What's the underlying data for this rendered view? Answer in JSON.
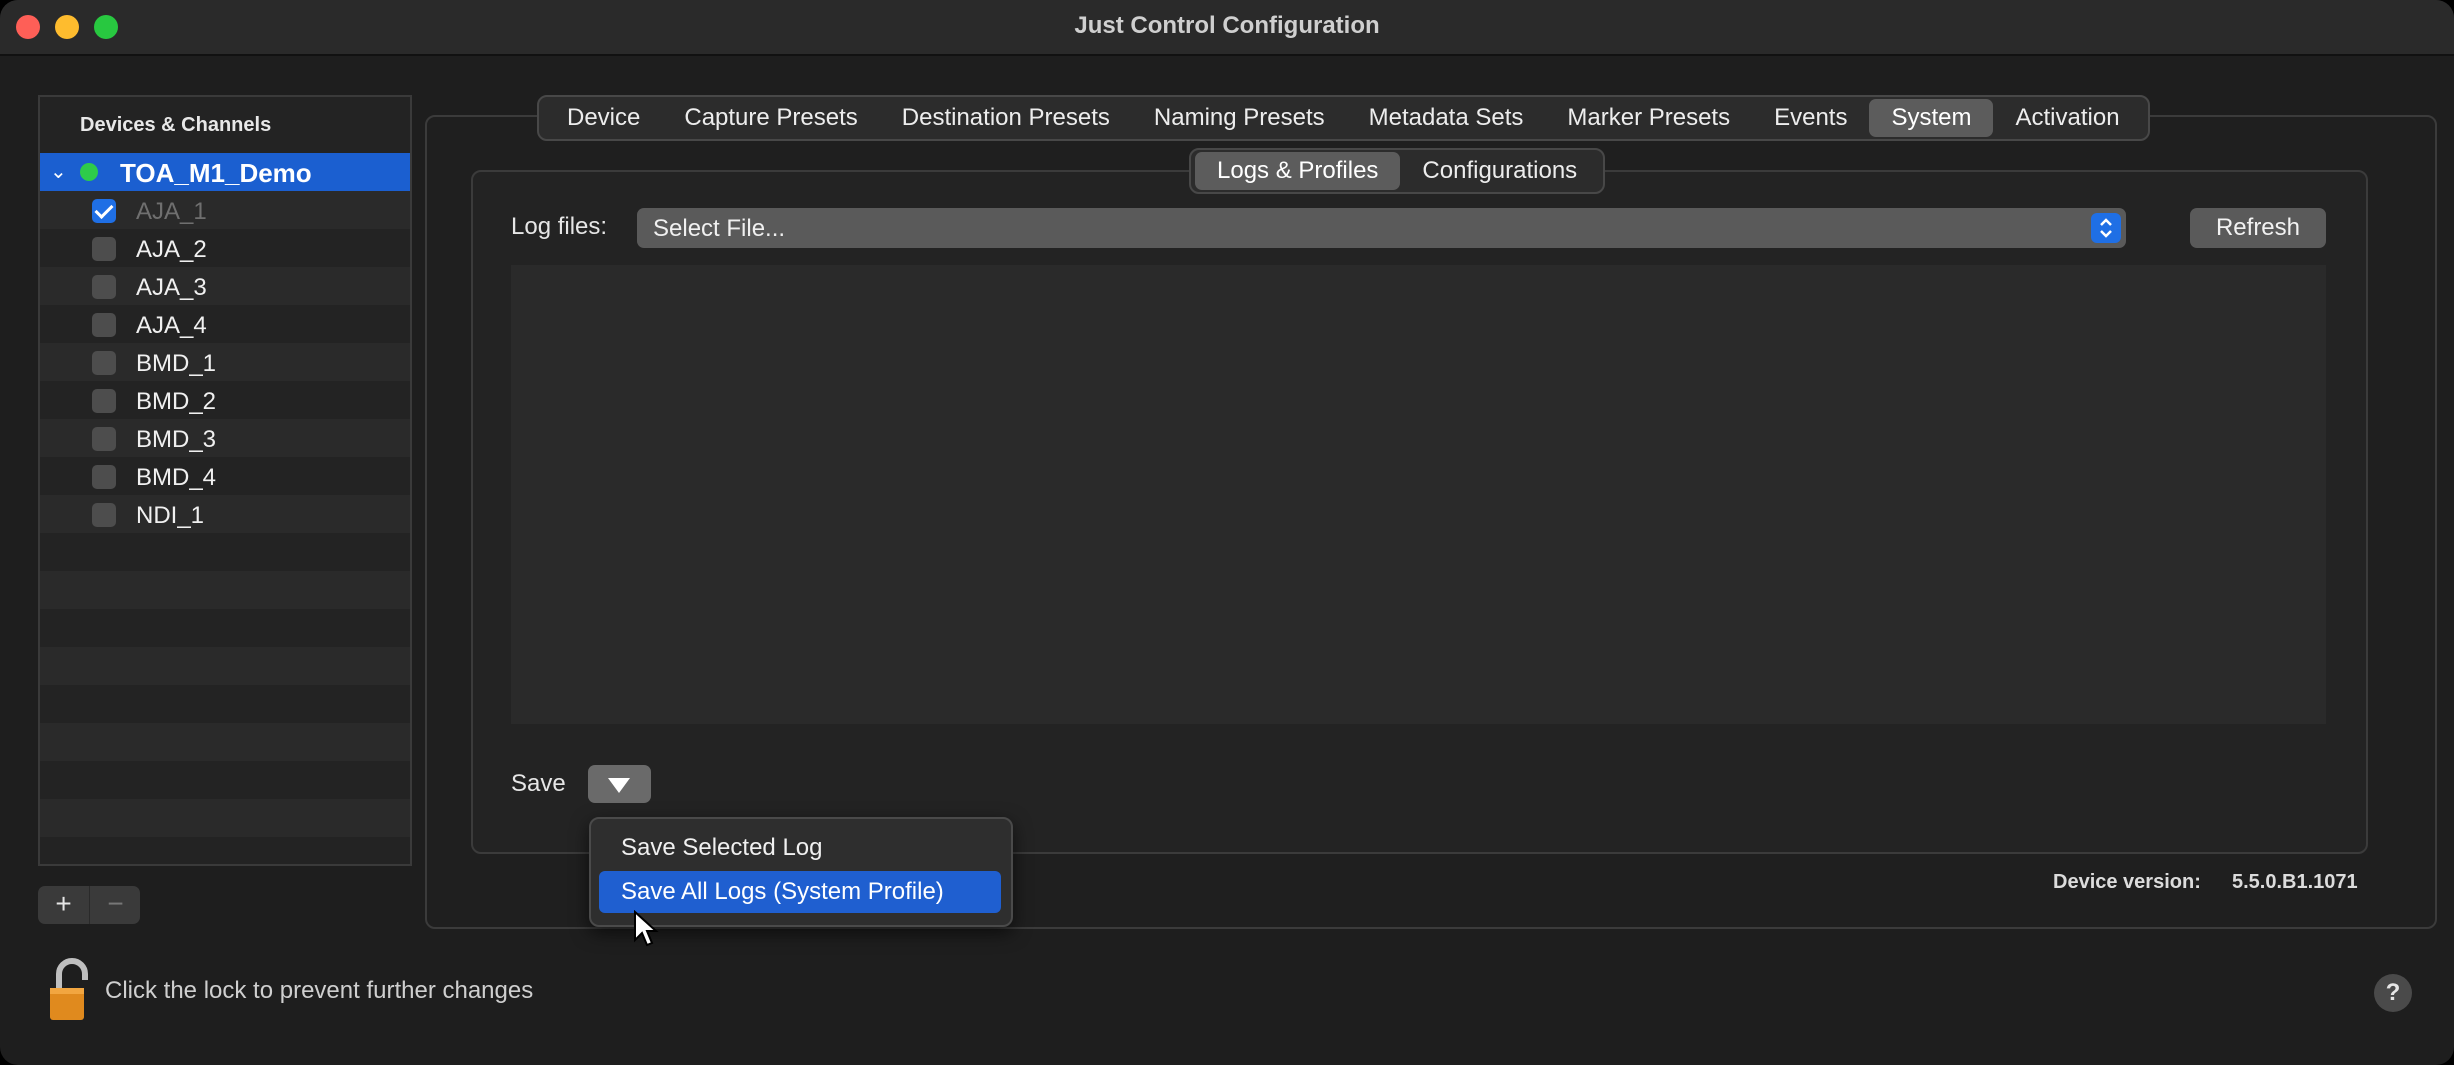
{
  "window": {
    "title": "Just Control Configuration",
    "traffic_lights": {
      "close": "#fe5f57",
      "minimize": "#febc2e",
      "zoom": "#28c840"
    }
  },
  "sidebar": {
    "header": "Devices & Channels",
    "device": {
      "name": "TOA_M1_Demo",
      "status_color": "#2ecb4a",
      "expanded": true
    },
    "channels": [
      {
        "label": "AJA_1",
        "checked": true,
        "dimmed": true
      },
      {
        "label": "AJA_2",
        "checked": false,
        "dimmed": false
      },
      {
        "label": "AJA_3",
        "checked": false,
        "dimmed": false
      },
      {
        "label": "AJA_4",
        "checked": false,
        "dimmed": false
      },
      {
        "label": "BMD_1",
        "checked": false,
        "dimmed": false
      },
      {
        "label": "BMD_2",
        "checked": false,
        "dimmed": false
      },
      {
        "label": "BMD_3",
        "checked": false,
        "dimmed": false
      },
      {
        "label": "BMD_4",
        "checked": false,
        "dimmed": false
      },
      {
        "label": "NDI_1",
        "checked": false,
        "dimmed": false
      }
    ],
    "add_label": "+",
    "remove_label": "−"
  },
  "tabs": [
    "Device",
    "Capture Presets",
    "Destination Presets",
    "Naming Presets",
    "Metadata Sets",
    "Marker Presets",
    "Events",
    "System",
    "Activation"
  ],
  "active_tab": "System",
  "subtabs": [
    "Logs & Profiles",
    "Configurations"
  ],
  "active_subtab": "Logs & Profiles",
  "logs": {
    "label": "Log files:",
    "select_value": "Select File...",
    "refresh_label": "Refresh",
    "save_label": "Save",
    "save_menu": [
      {
        "label": "Save Selected Log",
        "highlighted": false
      },
      {
        "label": "Save All Logs (System Profile)",
        "highlighted": true
      }
    ]
  },
  "device_version": {
    "label": "Device version:",
    "value": "5.5.0.B1.1071"
  },
  "lock_text": "Click the lock to prevent further changes",
  "help_label": "?",
  "accent_color": "#1f6fe5"
}
